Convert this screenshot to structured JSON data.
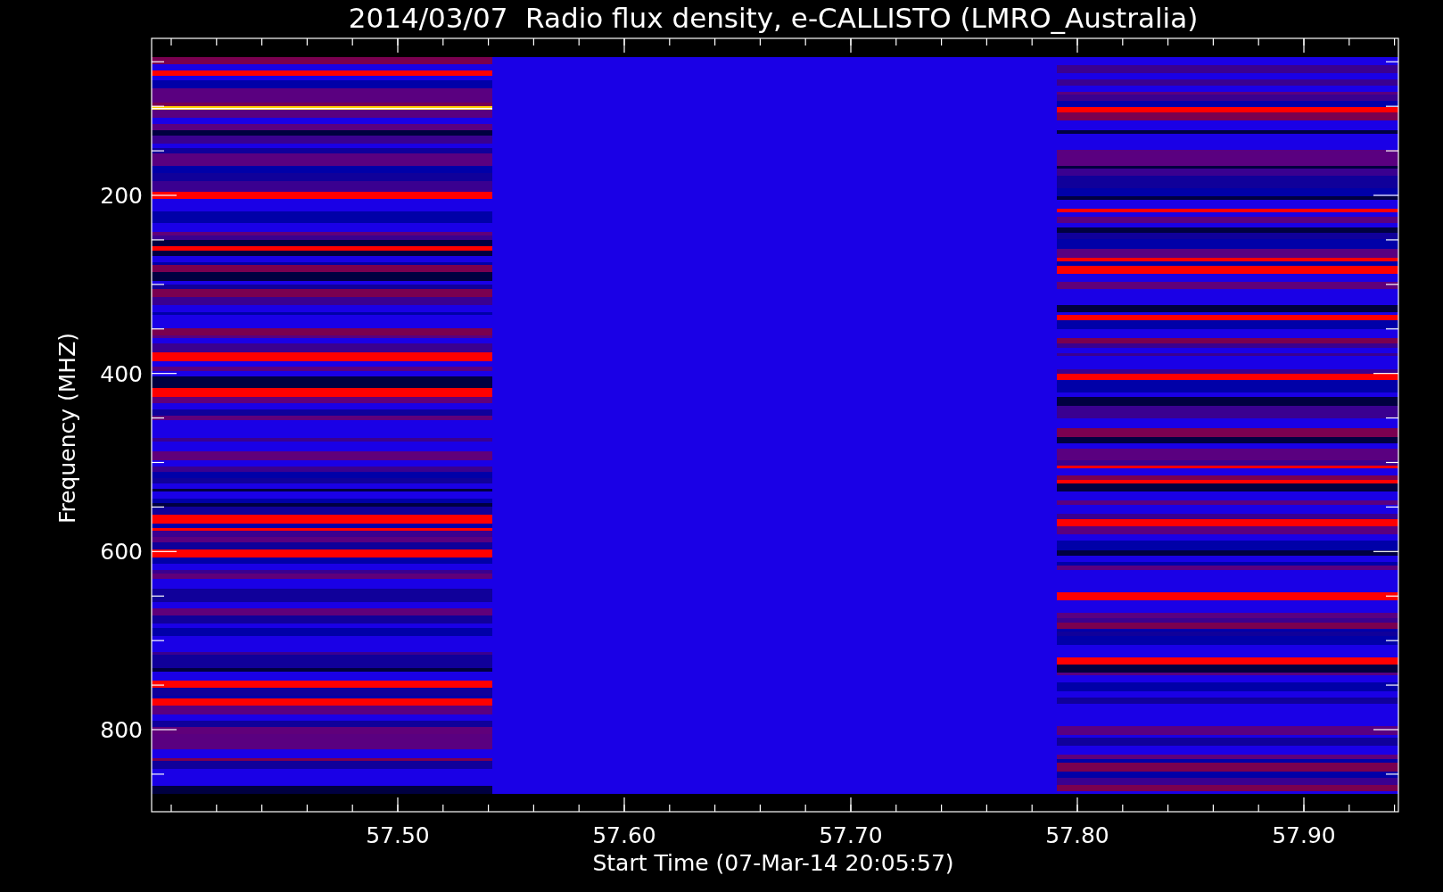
{
  "title": "2014/03/07  Radio flux density, e-CALLISTO (LMRO_Australia)",
  "xlabel": "Start Time (07-Mar-14 20:05:57)",
  "ylabel": "Frequency (MHZ)",
  "xticks": [
    "57.50",
    "57.60",
    "57.70",
    "57.80",
    "57.90"
  ],
  "yticks": [
    "200",
    "400",
    "600",
    "800"
  ]
}
